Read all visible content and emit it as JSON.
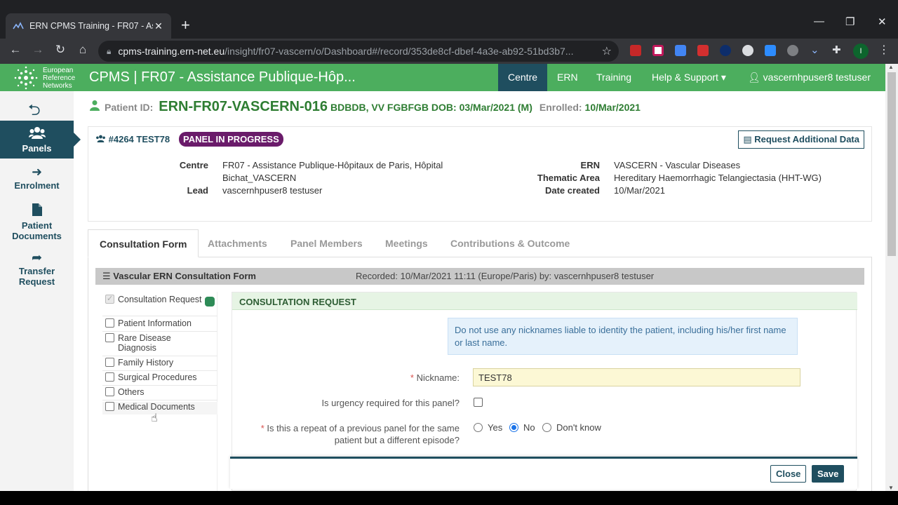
{
  "browser": {
    "tab_title": "ERN CPMS Training - FR07 - Assi",
    "url_host": "cpms-training.ern-net.eu",
    "url_path": "/insight/fr07-vascern/o/Dashboard#/record/353de8cf-dbef-4a3e-ab92-51bd3b7...",
    "profile_initial": "I"
  },
  "app": {
    "logo_text": [
      "European",
      "Reference",
      "Networks"
    ],
    "title": "CPMS | FR07 - Assistance Publique-Hôp...",
    "nav": [
      {
        "label": "Centre",
        "active": true
      },
      {
        "label": "ERN",
        "active": false
      },
      {
        "label": "Training",
        "active": false
      },
      {
        "label": "Help & Support ▾",
        "active": false
      },
      {
        "label": "vascernhpuser8 testuser ▾",
        "active": false
      }
    ],
    "accent": "#4cae5e",
    "dark": "#1f4e5f"
  },
  "sidebar": {
    "items": [
      {
        "label1": "Panels",
        "label2": "",
        "icon": "users-icon",
        "active": true
      },
      {
        "label1": "Enrolment",
        "label2": "",
        "icon": "sign-in-icon",
        "active": false
      },
      {
        "label1": "Patient",
        "label2": "Documents",
        "icon": "file-icon",
        "active": false
      },
      {
        "label1": "Transfer",
        "label2": "Request",
        "icon": "share-icon",
        "active": false
      }
    ]
  },
  "patient": {
    "id_label": "Patient ID:",
    "id": "ERN-FR07-VASCERN-016",
    "details": "BDBDB, VV FGBFGB DOB: 03/Mar/2021 (M)",
    "enrolled_label": "Enrolled:",
    "enrolled": "10/Mar/2021"
  },
  "panel": {
    "id": "#4264 TEST78",
    "status": "PANEL IN PROGRESS",
    "request_btn": "Request Additional Data",
    "centre_label": "Centre",
    "centre_value1": "FR07 - Assistance Publique-Hôpitaux de Paris, Hôpital",
    "centre_value2": "Bichat_VASCERN",
    "lead_label": "Lead",
    "lead_value": "vascernhpuser8 testuser",
    "ern_label": "ERN",
    "ern_value": "VASCERN - Vascular Diseases",
    "area_label": "Thematic Area",
    "area_value": "Hereditary Haemorrhagic Telangiectasia (HHT-WG)",
    "date_label": "Date created",
    "date_value": "10/Mar/2021"
  },
  "tabs": [
    {
      "label": "Consultation Form",
      "active": true
    },
    {
      "label": "Attachments",
      "active": false
    },
    {
      "label": "Panel Members",
      "active": false
    },
    {
      "label": "Meetings",
      "active": false
    },
    {
      "label": "Contributions & Outcome",
      "active": false
    }
  ],
  "form": {
    "title": "Vascular ERN Consultation Form",
    "recorded": "Recorded: 10/Mar/2021 11:11 (Europe/Paris) by: vascernhpuser8 testuser",
    "sections": [
      {
        "label1": "Consultation Request",
        "label2": "",
        "checked": true
      },
      {
        "label1": "Patient Information",
        "label2": "",
        "checked": false
      },
      {
        "label1": "Rare Disease",
        "label2": "Diagnosis",
        "checked": false
      },
      {
        "label1": "Family History",
        "label2": "",
        "checked": false
      },
      {
        "label1": "Surgical Procedures",
        "label2": "",
        "checked": false
      },
      {
        "label1": "Others",
        "label2": "",
        "checked": false
      },
      {
        "label1": "Medical Documents",
        "label2": "",
        "checked": false
      }
    ],
    "section_title": "CONSULTATION REQUEST",
    "info": "Do not use any nicknames liable to identity the patient, including his/her first name or last name.",
    "nickname_label": "Nickname:",
    "nickname_value": "TEST78",
    "urgency_label": "Is urgency required for this panel?",
    "repeat_label1": "Is this a repeat of a previous panel for the same",
    "repeat_label2": "patient but a different episode?",
    "repeat_options": [
      {
        "label": "Yes",
        "selected": false
      },
      {
        "label": "No",
        "selected": true
      },
      {
        "label": "Don't know",
        "selected": false
      }
    ],
    "close_btn": "Close",
    "save_btn": "Save"
  }
}
